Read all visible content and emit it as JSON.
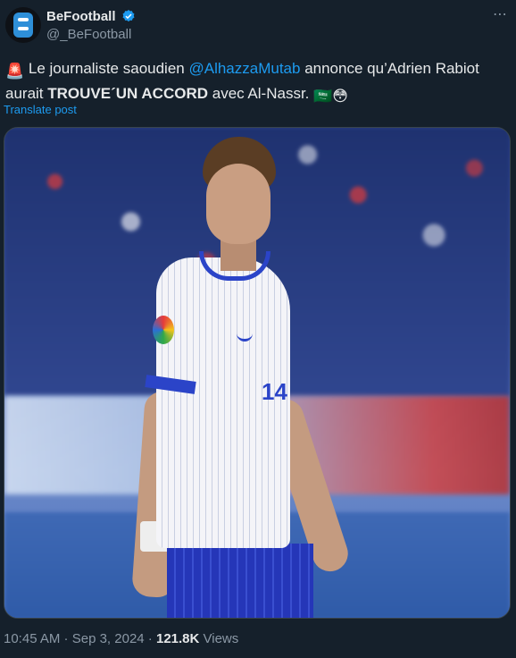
{
  "account": {
    "display_name": "BeFootball",
    "handle": "@_BeFootball"
  },
  "tweet": {
    "alarm_emoji": "🚨",
    "text_1": " Le journaliste saoudien ",
    "mention": "@AlhazzaMutab",
    "text_2": " annonce qu’Adrien Rabiot aurait ",
    "bold": "TROUVE´UN ACCORD",
    "text_3": " avec Al-Nassr. ",
    "flag_emoji": "🇸🇦",
    "face_emoji": "😳",
    "translate": "Translate post"
  },
  "meta": {
    "time": "10:45 AM",
    "sep": " · ",
    "date": "Sep 3, 2024",
    "views_count": "121.8K",
    "views_label": " Views"
  },
  "colors": {
    "background": "#15202b",
    "accent": "#1d9bf0",
    "muted": "#8b98a5"
  },
  "icons": [
    "verified-badge-icon",
    "more-options-icon",
    "avatar-logo-icon"
  ]
}
